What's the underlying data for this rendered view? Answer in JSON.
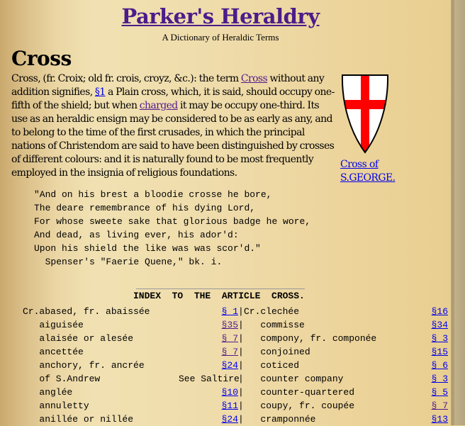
{
  "header": {
    "title": "Parker's Heraldry",
    "subtitle": "A Dictionary of Heraldic Terms"
  },
  "article": {
    "heading": "Cross",
    "p1_a": "Cross, (fr. Croix; old fr. crois, croyz, &c.): the term ",
    "link_cross": "Cross",
    "p1_b": " without any addition signifies, ",
    "link_s1": "§1",
    "p1_c": " a Plain cross, which, it is said, should occupy one-fifth of the shield; but when ",
    "link_charged": "charged",
    "p1_d": " it may be occupy one-third. Its use as an heraldic ensign may be considered to be as early as any, and to belong to the time of the first crusades, in which the principal nations of Christendom are said to have been distinguished by crosses of different colours: and it is naturally found to be most frequently employed in the insignia of religious foundations.",
    "image": {
      "icon": "shield-st-george-icon",
      "caption": "Cross of S.GEORGE.",
      "colors": {
        "field": "#ffffff",
        "cross": "#ff0000"
      }
    }
  },
  "quote": {
    "lines": [
      "\"And on his brest a bloodie crosse he bore,",
      "The deare remembrance of his dying Lord,",
      "For whose sweete sake that glorious badge he wore,",
      "And dead, as living ever, his ador'd:",
      "Upon his shield the like was was scor'd.\"",
      "  Spenser's \"Faerie Quene,\" bk. i."
    ]
  },
  "index": {
    "title": "INDEX  TO  THE  ARTICLE  CROSS.",
    "rows": [
      {
        "left": "Cr.abased, fr. abaissée",
        "left_ref": "§ 1",
        "right": "Cr.clechée",
        "right_ref": "§16"
      },
      {
        "left": "   aiguisée",
        "left_ref": "§35",
        "right": "   commisse",
        "right_ref": "§34"
      },
      {
        "left": "   alaisée or alesée",
        "left_ref": "§ 7",
        "right": "   compony, fr. componée",
        "right_ref": "§ 3"
      },
      {
        "left": "   ancettée",
        "left_ref": "§ 7",
        "right": "   conjoined",
        "right_ref": "§15"
      },
      {
        "left": "   anchory, fr. ancrée",
        "left_ref": "§24",
        "right": "   coticed",
        "right_ref": "§ 6"
      },
      {
        "left": "   of S.Andrew",
        "left_ref": "See Saltire",
        "left_ref_plain": true,
        "right": "   counter company",
        "right_ref": "§ 3"
      },
      {
        "left": "   anglée",
        "left_ref": "§10",
        "right": "   counter-quartered",
        "right_ref": "§ 5"
      },
      {
        "left": "   annuletty",
        "left_ref": "§11",
        "right": "   coupy, fr. coupée",
        "right_ref": "§ 7"
      },
      {
        "left": "   anillée or nillée",
        "left_ref": "§24",
        "right": "   cramponnée",
        "right_ref": "§13"
      }
    ]
  }
}
